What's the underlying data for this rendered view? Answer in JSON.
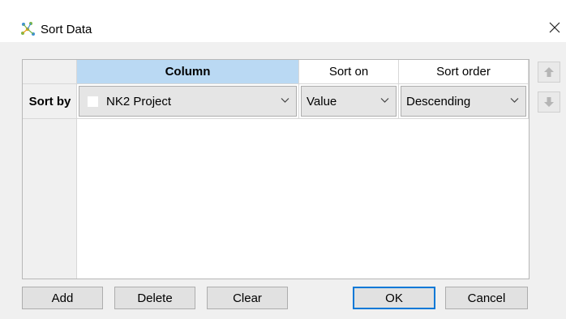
{
  "window": {
    "title": "Sort Data"
  },
  "grid": {
    "columns": [
      "Column",
      "Sort on",
      "Sort order"
    ],
    "rows": [
      {
        "header": "Sort by",
        "column": "NK2 Project",
        "sort_on": "Value",
        "sort_order": "Descending"
      }
    ]
  },
  "buttons": {
    "add": "Add",
    "delete": "Delete",
    "clear": "Clear",
    "ok": "OK",
    "cancel": "Cancel"
  },
  "colors": {
    "selected_header": "#bad9f3",
    "default_button_border": "#0078d7"
  }
}
